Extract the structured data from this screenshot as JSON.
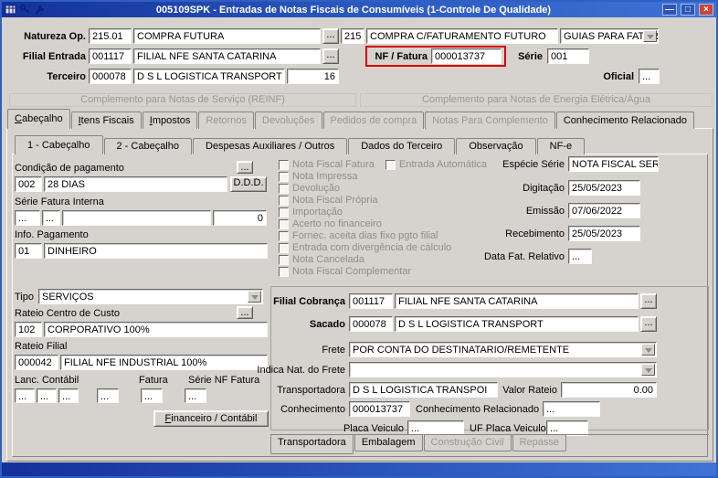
{
  "window": {
    "title": "005109SPK - Entradas de Notas Fiscais de Consumíveis (1-Controle De Qualidade)",
    "controls": {
      "minimize": "—",
      "maximize": "□",
      "close": "×"
    }
  },
  "header": {
    "natureza": {
      "label": "Natureza Op.",
      "code": "215.01",
      "desc": "COMPRA FUTURA",
      "lookup": "...",
      "num": "215",
      "tipo": "COMPRA C/FATURAMENTO FUTURO",
      "guias": "GUIAS PARA FATURAI"
    },
    "filial": {
      "label": "Filial Entrada",
      "code": "001117",
      "desc": "FILIAL NFE SANTA CATARINA",
      "lookup": "..."
    },
    "nf": {
      "label": "NF / Fatura",
      "value": "000013737"
    },
    "serie": {
      "label": "Série",
      "value": "001"
    },
    "terceiro": {
      "label": "Terceiro",
      "code": "000078",
      "desc": "D S L LOGISTICA TRANSPORT",
      "num": "16"
    },
    "oficial": {
      "label": "Oficial",
      "value": "..."
    }
  },
  "links": {
    "reinf": "Complemento para Notas de Serviço (REINF)",
    "energia": "Complemento para Notas de Energia Elétrica/Água"
  },
  "main_tabs": [
    {
      "label": "Cabeçalho",
      "state": "active"
    },
    {
      "label": "Itens Fiscais",
      "state": "enabled"
    },
    {
      "label": "Impostos",
      "state": "enabled"
    },
    {
      "label": "Retornos",
      "state": "disabled"
    },
    {
      "label": "Devoluções",
      "state": "disabled"
    },
    {
      "label": "Pedidos de compra",
      "state": "disabled"
    },
    {
      "label": "Notas Para Complemento",
      "state": "disabled"
    },
    {
      "label": "Conhecimento Relacionado",
      "state": "enabled"
    }
  ],
  "sub_tabs": [
    {
      "label": "1 - Cabeçalho",
      "state": "active"
    },
    {
      "label": "2 - Cabeçalho",
      "state": "enabled"
    },
    {
      "label": "Despesas Auxiliares / Outros",
      "state": "enabled"
    },
    {
      "label": "Dados do Terceiro",
      "state": "enabled"
    },
    {
      "label": "Observação",
      "state": "enabled"
    },
    {
      "label": "NF-e",
      "state": "enabled"
    }
  ],
  "left": {
    "cond_pag": {
      "label": "Condição de pagamento",
      "lookup": "...",
      "code": "002",
      "desc": "28 DIAS",
      "ddd": "D.D.D."
    },
    "serie_fatura": {
      "label": "Série Fatura Interna",
      "f1": "...",
      "f2": "...",
      "f3": "",
      "f4": "0"
    },
    "info_pag": {
      "label": "Info. Pagamento",
      "code": "01",
      "desc": "DINHEIRO"
    },
    "tipo": {
      "label": "Tipo",
      "value": "SERVIÇOS"
    },
    "rateio_cc": {
      "label": "Rateio Centro de Custo",
      "lookup": "...",
      "code": "102",
      "desc": "CORPORATIVO 100%"
    },
    "rateio_filial": {
      "label": "Rateio Filial",
      "code": "000042",
      "desc": "FILIAL NFE INDUSTRIAL 100%"
    },
    "lanc": {
      "label": "Lanc. Contábil",
      "fatura_label": "Fatura",
      "serie_label": "Série NF Fatura",
      "d1": "...",
      "d2": "...",
      "d3": "...",
      "d4": "...",
      "d5": "...",
      "d6": "..."
    },
    "financeiro_btn": "Financeiro / Contábil"
  },
  "checkboxes": [
    "Nota Fiscal Fatura",
    "Entrada Automática",
    "Nota Impressa",
    "Devolução",
    "Nota Fiscal Própria",
    "Importação",
    "Acerto no financeiro",
    "Fornec. aceita dias fixo pgto filial",
    "Entrada com divergência de cálculo",
    "Nota Cancelada",
    "Nota Fiscal Complementar"
  ],
  "dates": {
    "especie": {
      "label": "Espécie Série",
      "value": "NOTA FISCAL SER"
    },
    "digitacao": {
      "label": "Digitação",
      "value": "25/05/2023"
    },
    "emissao": {
      "label": "Emissão",
      "value": "07/06/2022"
    },
    "recebimento": {
      "label": "Recebimento",
      "value": "25/05/2023"
    },
    "data_fat": {
      "label": "Data Fat. Relativo",
      "value": "..."
    }
  },
  "cobranca": {
    "filial": {
      "label": "Filial Cobrança",
      "code": "001117",
      "desc": "FILIAL NFE SANTA CATARINA",
      "lookup": "..."
    },
    "sacado": {
      "label": "Sacado",
      "code": "000078",
      "desc": "D S L LOGISTICA TRANSPORT",
      "lookup": "..."
    },
    "frete": {
      "label": "Frete",
      "value": "POR CONTA DO DESTINATARIO/REMETENTE"
    },
    "indica": {
      "label": "Indica Nat. do Frete",
      "value": ""
    },
    "transportadora": {
      "label": "Transportadora",
      "value": "D S L LOGISTICA TRANSPOI"
    },
    "valor_rateio": {
      "label": "Valor Rateio",
      "value": "0.00"
    },
    "conhecimento": {
      "label": "Conhecimento",
      "value": "000013737"
    },
    "conhecimento_rel": {
      "label": "Conhecimento Relacionado",
      "value": "..."
    },
    "placa": {
      "label": "Placa Veiculo",
      "value": "..."
    },
    "uf_placa": {
      "label": "UF Placa Veiculo",
      "value": "..."
    }
  },
  "bottom_tabs": [
    {
      "label": "Transportadora",
      "state": "active"
    },
    {
      "label": "Embalagem",
      "state": "enabled"
    },
    {
      "label": "Construção Civil",
      "state": "disabled"
    },
    {
      "label": "Repasse",
      "state": "disabled"
    }
  ],
  "colors": {
    "titlebar_blue": "#14319a",
    "highlight_red": "#d60000",
    "window_bg": "#d6d3ce",
    "disabled_text": "#9a978f"
  }
}
